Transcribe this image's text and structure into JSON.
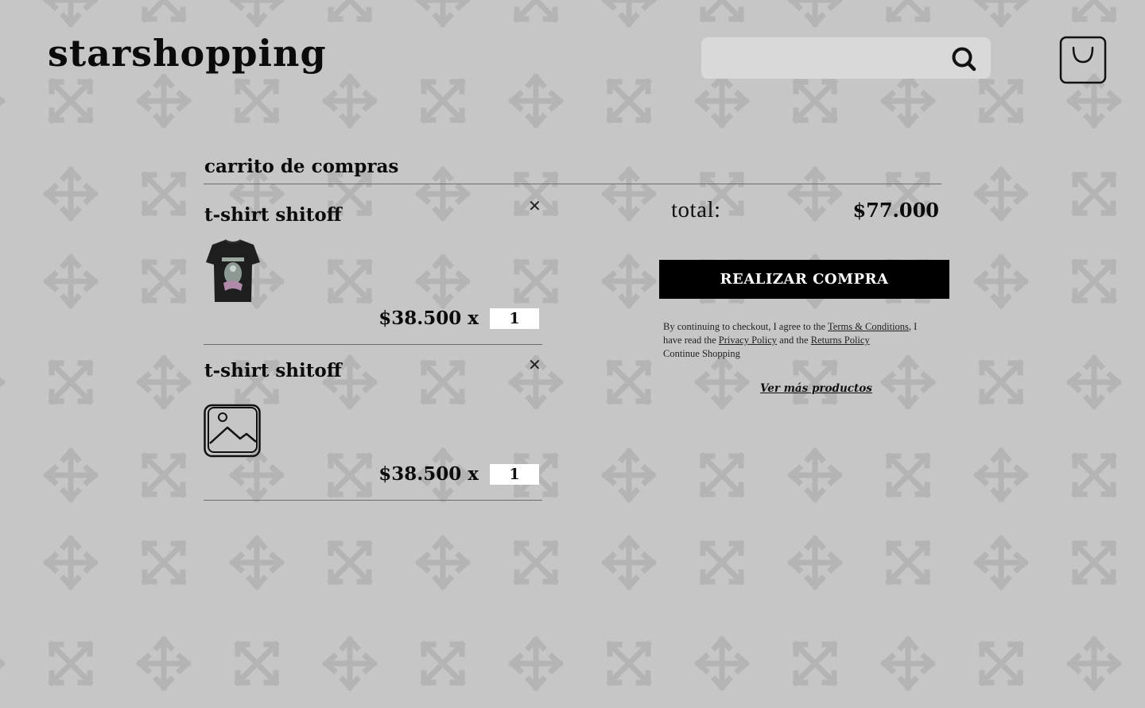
{
  "header": {
    "logo_text": "starshopping",
    "search": {
      "value": "",
      "placeholder": ""
    },
    "icons": {
      "search": "search-icon",
      "cart": "shopping-bag-icon"
    }
  },
  "cart": {
    "title": "carrito de compras",
    "items": [
      {
        "name": "t-shirt shitoff",
        "price": "$38.500",
        "multiplier": "x",
        "quantity": "1",
        "remove_label": "✕",
        "image": "black-metallica-tshirt-image"
      },
      {
        "name": "t-shirt shitoff",
        "price": "$38.500",
        "multiplier": "x",
        "quantity": "1",
        "remove_label": "✕",
        "image": "image-placeholder-icon"
      }
    ]
  },
  "summary": {
    "total_label": "total:",
    "total_value": "$77.000",
    "checkout_label": "REALIZAR COMPRA",
    "legal": {
      "part1": "By continuing to checkout, I agree to the ",
      "terms_link": "Terms & Conditions",
      "part2": ", I have read the ",
      "privacy_link": "Privacy Policy",
      "part3": " and the ",
      "returns_link": "Returns Policy",
      "continue_shopping": "Continue Shopping"
    },
    "more_products_link": "Ver más productos"
  },
  "colors": {
    "background": "#c6c6c6",
    "pattern": "#b5b5b5",
    "button_bg": "#000000",
    "button_text": "#ffffff",
    "search_bg": "#d9d9d9"
  }
}
